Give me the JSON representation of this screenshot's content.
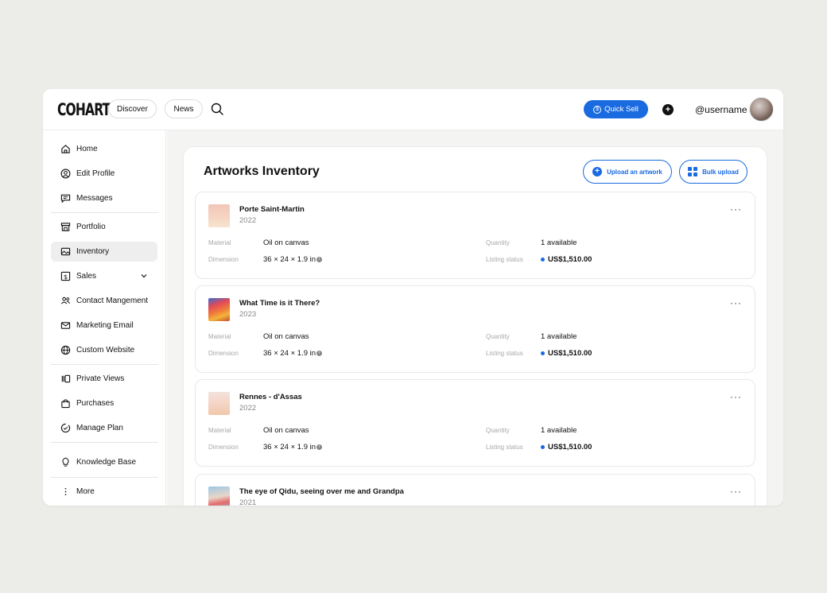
{
  "app": {
    "logo": "COHART"
  },
  "header": {
    "tabs": [
      {
        "label": "Discover"
      },
      {
        "label": "News"
      }
    ],
    "quick_sell_label": "Quick Sell",
    "username": "@username",
    "colors": {
      "accent": "#1a6ae0"
    }
  },
  "sidebar": {
    "items": [
      {
        "label": "Home",
        "icon": "home-icon"
      },
      {
        "label": "Edit Profile",
        "icon": "user-circle-icon"
      },
      {
        "label": "Messages",
        "icon": "message-icon"
      },
      {
        "label": "Portfolio",
        "icon": "storefront-icon"
      },
      {
        "label": "Inventory",
        "icon": "image-icon",
        "active": true
      },
      {
        "label": "Sales",
        "icon": "dollar-icon",
        "expandable": true
      },
      {
        "label": "Contact Mangement",
        "icon": "users-icon"
      },
      {
        "label": "Marketing Email",
        "icon": "mail-icon"
      },
      {
        "label": "Custom Website",
        "icon": "globe-icon"
      },
      {
        "label": "Private Views",
        "icon": "private-views-icon"
      },
      {
        "label": "Purchases",
        "icon": "shopping-bag-icon"
      },
      {
        "label": "Manage Plan",
        "icon": "plan-icon"
      },
      {
        "label": "Knowledge Base",
        "icon": "lightbulb-icon"
      },
      {
        "label": "More",
        "icon": "more-vertical-icon"
      }
    ]
  },
  "main": {
    "title": "Artworks Inventory",
    "upload_label": "Upload an artwork",
    "bulk_label": "Bulk upload",
    "field_labels": {
      "material": "Material",
      "dimension": "Dimension",
      "quantity": "Quantity",
      "listing_status": "Listing status"
    },
    "artworks": [
      {
        "title": "Porte Saint-Martin",
        "year": "2022",
        "material": "Oil on canvas",
        "dimension": "36 × 24 × 1.9 in",
        "quantity": "1 available",
        "price": "US$1,510.00"
      },
      {
        "title": "What Time is it There?",
        "year": "2023",
        "material": "Oil on canvas",
        "dimension": "36 × 24 × 1.9 in",
        "quantity": "1 available",
        "price": "US$1,510.00"
      },
      {
        "title": "Rennes - d'Assas",
        "year": "2022",
        "material": "Oil on canvas",
        "dimension": "36 × 24 × 1.9 in",
        "quantity": "1 available",
        "price": "US$1,510.00"
      },
      {
        "title": "The eye of Qidu, seeing over me and Grandpa",
        "year": "2021"
      }
    ]
  }
}
